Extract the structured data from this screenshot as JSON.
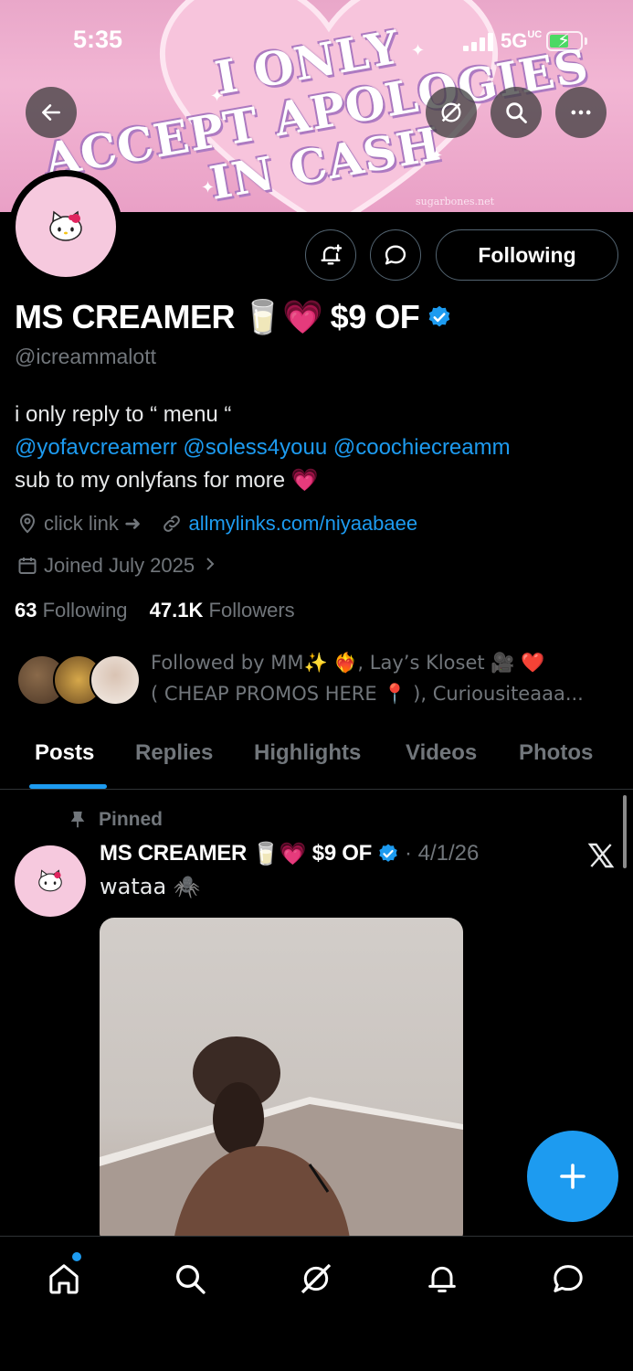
{
  "status_bar": {
    "time": "5:35",
    "network": "5G",
    "network_sup": "UC"
  },
  "banner": {
    "lines": [
      "I ONLY",
      "ACCEPT APOLOGIES",
      "IN CASH"
    ],
    "watermark": "sugarbones.net"
  },
  "profile": {
    "name": "MS CREAMER",
    "name_emojis": "🥛💗",
    "name_suffix": "$9 OF",
    "handle": "@icreammalott",
    "follow_button": "Following",
    "bio_line1": "i only reply to “ menu “",
    "bio_mentions": "@yofavcreamerr @soless4youu @coochiecreamm",
    "bio_line3": "sub to my onlyfans for more 💗",
    "location": "click link ➜",
    "website": "allmylinks.com/niyaabaee",
    "joined": "Joined July 2025",
    "following_count": "63",
    "following_label": "Following",
    "followers_count": "47.1K",
    "followers_label": "Followers",
    "followed_by_line1": "Followed by MM✨ ❤️‍🔥, Lay’s Kloset 🎥 ❤️",
    "followed_by_line2": "( CHEAP PROMOS HERE 📍 ), Curiousiteaaa..."
  },
  "tabs": [
    "Posts",
    "Replies",
    "Highlights",
    "Videos",
    "Photos"
  ],
  "active_tab": "Posts",
  "pinned_post": {
    "pinned_label": "Pinned",
    "author": "MS CREAMER",
    "author_emojis": "🥛💗",
    "author_suffix": "$9 OF",
    "date": "· 4/1/26",
    "text": "wataa 🕷️"
  },
  "icons": {
    "back": "arrow-left-icon",
    "grok": "grok-icon",
    "search": "search-icon",
    "more": "more-icon",
    "notify": "bell-plus-icon",
    "message": "message-icon",
    "nav": [
      "home-icon",
      "search-icon",
      "grok-icon",
      "bell-icon",
      "chat-icon"
    ]
  },
  "colors": {
    "accent": "#1d9bf0",
    "background": "#000000",
    "muted": "#71767b",
    "banner_pink": "#f2b6d4"
  }
}
